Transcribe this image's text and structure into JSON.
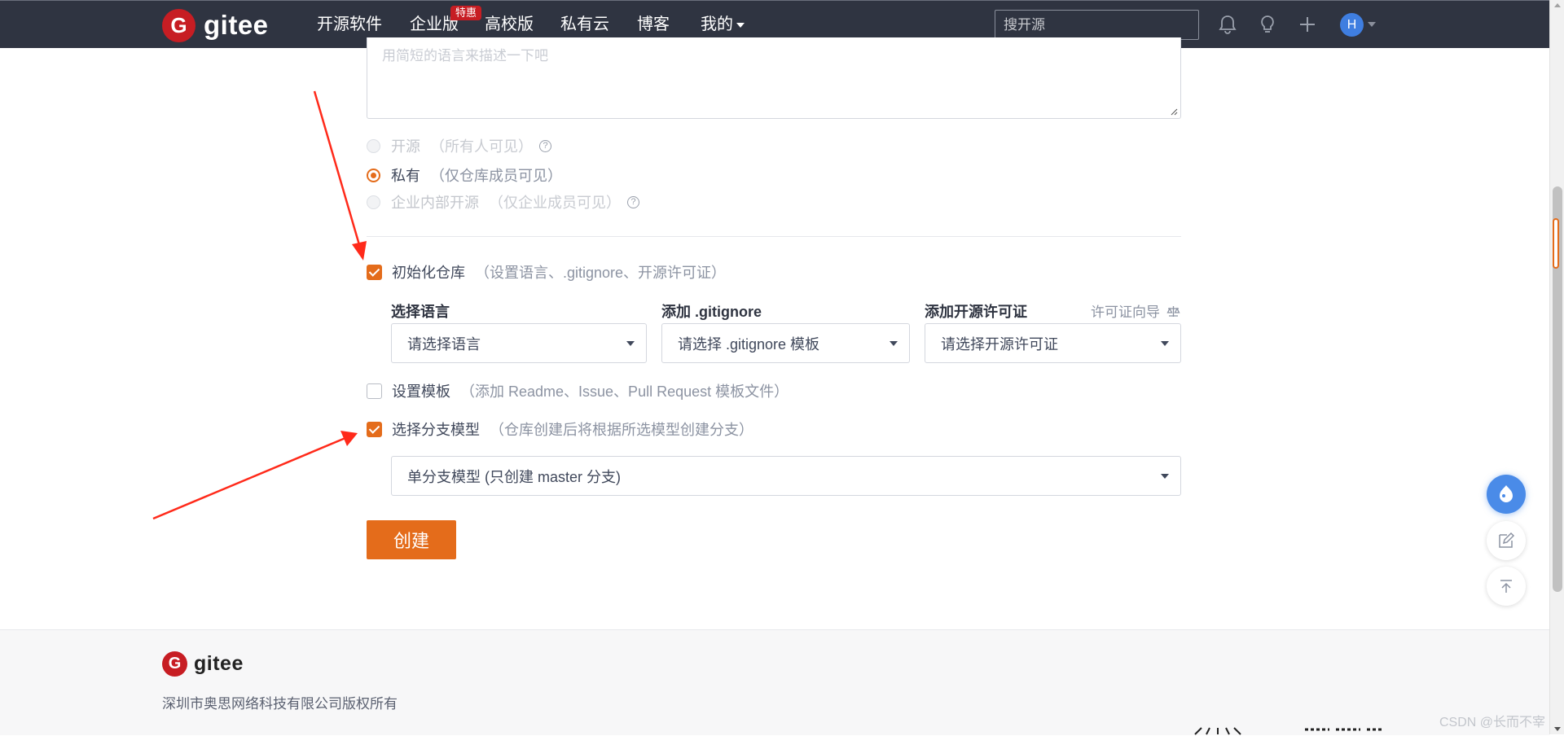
{
  "navbar": {
    "logo_mark": "G",
    "logo_text": "gitee",
    "items": [
      "开源软件",
      "企业版",
      "高校版",
      "私有云",
      "博客",
      "我的"
    ],
    "hot_badge": "特惠",
    "search_placeholder": "搜开源",
    "icons": [
      "bell-icon",
      "lightbulb-icon",
      "plus-icon"
    ],
    "avatar_letter": "H"
  },
  "form": {
    "description_placeholder": "用简短的语言来描述一下吧",
    "visibility": [
      {
        "label": "开源",
        "hint": "（所有人可见）",
        "selected": false,
        "disabled": true,
        "help": true
      },
      {
        "label": "私有",
        "hint": "（仅仓库成员可见）",
        "selected": true,
        "disabled": false,
        "help": false
      },
      {
        "label": "企业内部开源",
        "hint": "（仅企业成员可见）",
        "selected": false,
        "disabled": true,
        "help": true
      }
    ],
    "init_repo": {
      "label": "初始化仓库",
      "hint": "（设置语言、.gitignore、开源许可证）",
      "checked": true
    },
    "language": {
      "label": "选择语言",
      "value": "请选择语言"
    },
    "gitignore": {
      "label": "添加 .gitignore",
      "value": "请选择 .gitignore 模板"
    },
    "license": {
      "label": "添加开源许可证",
      "value": "请选择开源许可证",
      "guide": "许可证向导"
    },
    "template": {
      "label": "设置模板",
      "hint": "（添加 Readme、Issue、Pull Request 模板文件）",
      "checked": false
    },
    "branch_model": {
      "label": "选择分支模型",
      "hint": "（仓库创建后将根据所选模型创建分支）",
      "checked": true,
      "value": "单分支模型 (只创建 master 分支)"
    },
    "create_button": "创建"
  },
  "footer": {
    "logo_mark": "G",
    "logo_text": "gitee",
    "copyright": "深圳市奥思网络科技有限公司版权所有"
  },
  "watermark": "CSDN @长而不宰",
  "colors": {
    "accent": "#e46c1b",
    "navbar": "#2f3441",
    "brand_red": "#c71d23",
    "annotation_arrow": "#ff2a1a"
  }
}
